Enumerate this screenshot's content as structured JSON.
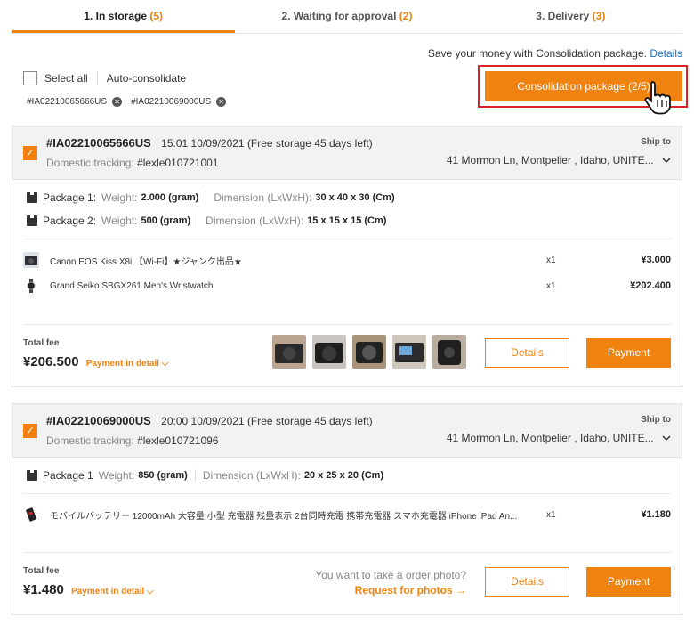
{
  "tabs": [
    {
      "label": "1. In storage",
      "count": "(5)"
    },
    {
      "label": "2. Waiting for approval",
      "count": "(2)"
    },
    {
      "label": "3. Delivery",
      "count": "(3)"
    }
  ],
  "promo": {
    "text": "Save your money with Consolidation package.",
    "link": "Details"
  },
  "toolbar": {
    "select_all": "Select all",
    "auto_consolidate": "Auto-consolidate",
    "selected_chips": [
      "#IA02210065666US",
      "#IA02210069000US"
    ],
    "consolidation_button": "Consolidation package (2/5)"
  },
  "orders": [
    {
      "id": "#IA02210065666US",
      "datetime": "15:01 10/09/2021",
      "storage_note": "(Free storage 45 days left)",
      "tracking_label": "Domestic tracking:",
      "tracking": "#lexle010721001",
      "ship_to_label": "Ship to",
      "address": "41 Mormon Ln, Montpelier , Idaho, UNITE...",
      "packages": [
        {
          "label": "Package 1:",
          "weight_label": "Weight:",
          "weight": "2.000 (gram)",
          "dim_label": "Dimension (LxWxH):",
          "dim": "30 x 40 x 30 (Cm)"
        },
        {
          "label": "Package 2:",
          "weight_label": "Weight:",
          "weight": "500 (gram)",
          "dim_label": "Dimension (LxWxH):",
          "dim": "15 x 15 x 15 (Cm)"
        }
      ],
      "items": [
        {
          "name": "Canon EOS Kiss X8i 【Wi-Fi】★ジャンク出品★",
          "qty": "x1",
          "price": "¥3.000"
        },
        {
          "name": "Grand Seiko SBGX261 Men's Wristwatch",
          "qty": "x1",
          "price": "¥202.400"
        }
      ],
      "total_label": "Total fee",
      "total": "¥206.500",
      "payment_detail": "Payment in detail",
      "details_button": "Details",
      "payment_button": "Payment"
    },
    {
      "id": "#IA02210069000US",
      "datetime": "20:00 10/09/2021",
      "storage_note": "(Free storage 45 days left)",
      "tracking_label": "Domestic tracking:",
      "tracking": "#lexle010721096",
      "ship_to_label": "Ship to",
      "address": "41 Mormon Ln, Montpelier , Idaho, UNITE...",
      "packages": [
        {
          "label": "Package 1",
          "weight_label": "Weight:",
          "weight": "850 (gram)",
          "dim_label": "Dimension (LxWxH):",
          "dim": "20 x 25 x 20 (Cm)"
        }
      ],
      "items": [
        {
          "name": "モバイルバッテリー 12000mAh 大容量 小型 充電器 残量表示 2台同時充電 携帯充電器 スマホ充電器 iPhone iPad An...",
          "qty": "x1",
          "price": "¥1.180"
        }
      ],
      "total_label": "Total fee",
      "total": "¥1.480",
      "payment_detail": "Payment in detail",
      "photo_question": "You want to take a order photo?",
      "photo_request": "Request for photos",
      "details_button": "Details",
      "payment_button": "Payment"
    }
  ],
  "colors": {
    "accent": "#f0820f",
    "highlight": "#d9232a",
    "link": "#1a6fc9"
  }
}
